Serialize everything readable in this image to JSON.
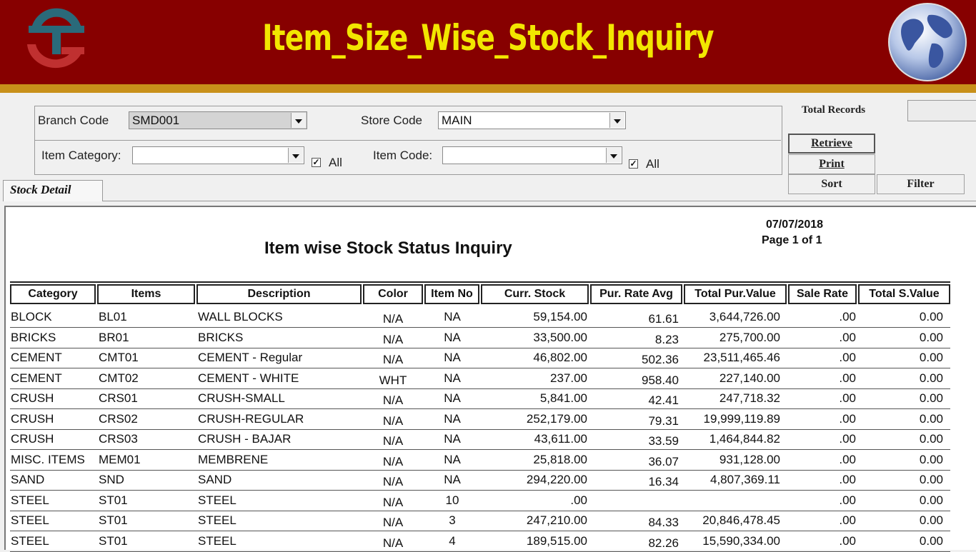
{
  "header": {
    "title": "Item_Size_Wise_Stock_Inquiry",
    "logo_icon": "ts-logo-icon",
    "globe_icon": "globe-icon",
    "banner_color": "#870000",
    "title_color": "#f2e600"
  },
  "filters": {
    "branch_label": "Branch Code",
    "branch_value": "SMD001",
    "store_label": "Store Code",
    "store_value": "MAIN",
    "category_label": "Item Category:",
    "category_value": "",
    "category_all_label": "All",
    "category_all_checked": true,
    "code_label": "Item Code:",
    "code_value": "",
    "code_all_label": "All",
    "code_all_checked": true
  },
  "side": {
    "total_records_label": "Total Records",
    "total_records_value": "",
    "retrieve_label": "Retrieve",
    "print_label": "Print",
    "sort_label": "Sort",
    "filter_label": "Filter"
  },
  "tabs": [
    {
      "label": "Stock Detail",
      "active": true
    }
  ],
  "report": {
    "date": "07/07/2018",
    "page": "Page 1 of 1",
    "title": "Item wise Stock Status Inquiry",
    "columns": [
      "Category",
      "Items",
      "Description",
      "Color",
      "Item No",
      "Curr. Stock",
      "Pur. Rate Avg",
      "Total Pur.Value",
      "Sale Rate",
      "Total S.Value"
    ],
    "rows": [
      {
        "category": "BLOCK",
        "item": "BL01",
        "description": "WALL BLOCKS",
        "color": "N/A",
        "item_no": "NA",
        "curr_stock": "59,154.00",
        "pur_rate": "61.61",
        "total_pur": "3,644,726.00",
        "sale_rate": ".00",
        "total_s": "0.00"
      },
      {
        "category": "BRICKS",
        "item": "BR01",
        "description": "BRICKS",
        "color": "N/A",
        "item_no": "NA",
        "curr_stock": "33,500.00",
        "pur_rate": "8.23",
        "total_pur": "275,700.00",
        "sale_rate": ".00",
        "total_s": "0.00"
      },
      {
        "category": "CEMENT",
        "item": "CMT01",
        "description": "CEMENT - Regular",
        "color": "N/A",
        "item_no": "NA",
        "curr_stock": "46,802.00",
        "pur_rate": "502.36",
        "total_pur": "23,511,465.46",
        "sale_rate": ".00",
        "total_s": "0.00"
      },
      {
        "category": "CEMENT",
        "item": "CMT02",
        "description": "CEMENT - WHITE",
        "color": "WHT",
        "item_no": "NA",
        "curr_stock": "237.00",
        "pur_rate": "958.40",
        "total_pur": "227,140.00",
        "sale_rate": ".00",
        "total_s": "0.00"
      },
      {
        "category": "CRUSH",
        "item": "CRS01",
        "description": "CRUSH-SMALL",
        "color": "N/A",
        "item_no": "NA",
        "curr_stock": "5,841.00",
        "pur_rate": "42.41",
        "total_pur": "247,718.32",
        "sale_rate": ".00",
        "total_s": "0.00"
      },
      {
        "category": "CRUSH",
        "item": "CRS02",
        "description": "CRUSH-REGULAR",
        "color": "N/A",
        "item_no": "NA",
        "curr_stock": "252,179.00",
        "pur_rate": "79.31",
        "total_pur": "19,999,119.89",
        "sale_rate": ".00",
        "total_s": "0.00"
      },
      {
        "category": "CRUSH",
        "item": "CRS03",
        "description": "CRUSH - BAJAR",
        "color": "N/A",
        "item_no": "NA",
        "curr_stock": "43,611.00",
        "pur_rate": "33.59",
        "total_pur": "1,464,844.82",
        "sale_rate": ".00",
        "total_s": "0.00"
      },
      {
        "category": "MISC. ITEMS",
        "item": "MEM01",
        "description": "MEMBRENE",
        "color": "N/A",
        "item_no": "NA",
        "curr_stock": "25,818.00",
        "pur_rate": "36.07",
        "total_pur": "931,128.00",
        "sale_rate": ".00",
        "total_s": "0.00"
      },
      {
        "category": "SAND",
        "item": "SND",
        "description": "SAND",
        "color": "N/A",
        "item_no": "NA",
        "curr_stock": "294,220.00",
        "pur_rate": "16.34",
        "total_pur": "4,807,369.11",
        "sale_rate": ".00",
        "total_s": "0.00"
      },
      {
        "category": "STEEL",
        "item": "ST01",
        "description": "STEEL",
        "color": "N/A",
        "item_no": "10",
        "curr_stock": ".00",
        "pur_rate": "",
        "total_pur": "",
        "sale_rate": ".00",
        "total_s": "0.00"
      },
      {
        "category": "STEEL",
        "item": "ST01",
        "description": "STEEL",
        "color": "N/A",
        "item_no": "3",
        "curr_stock": "247,210.00",
        "pur_rate": "84.33",
        "total_pur": "20,846,478.45",
        "sale_rate": ".00",
        "total_s": "0.00"
      },
      {
        "category": "STEEL",
        "item": "ST01",
        "description": "STEEL",
        "color": "N/A",
        "item_no": "4",
        "curr_stock": "189,515.00",
        "pur_rate": "82.26",
        "total_pur": "15,590,334.00",
        "sale_rate": ".00",
        "total_s": "0.00"
      }
    ]
  }
}
